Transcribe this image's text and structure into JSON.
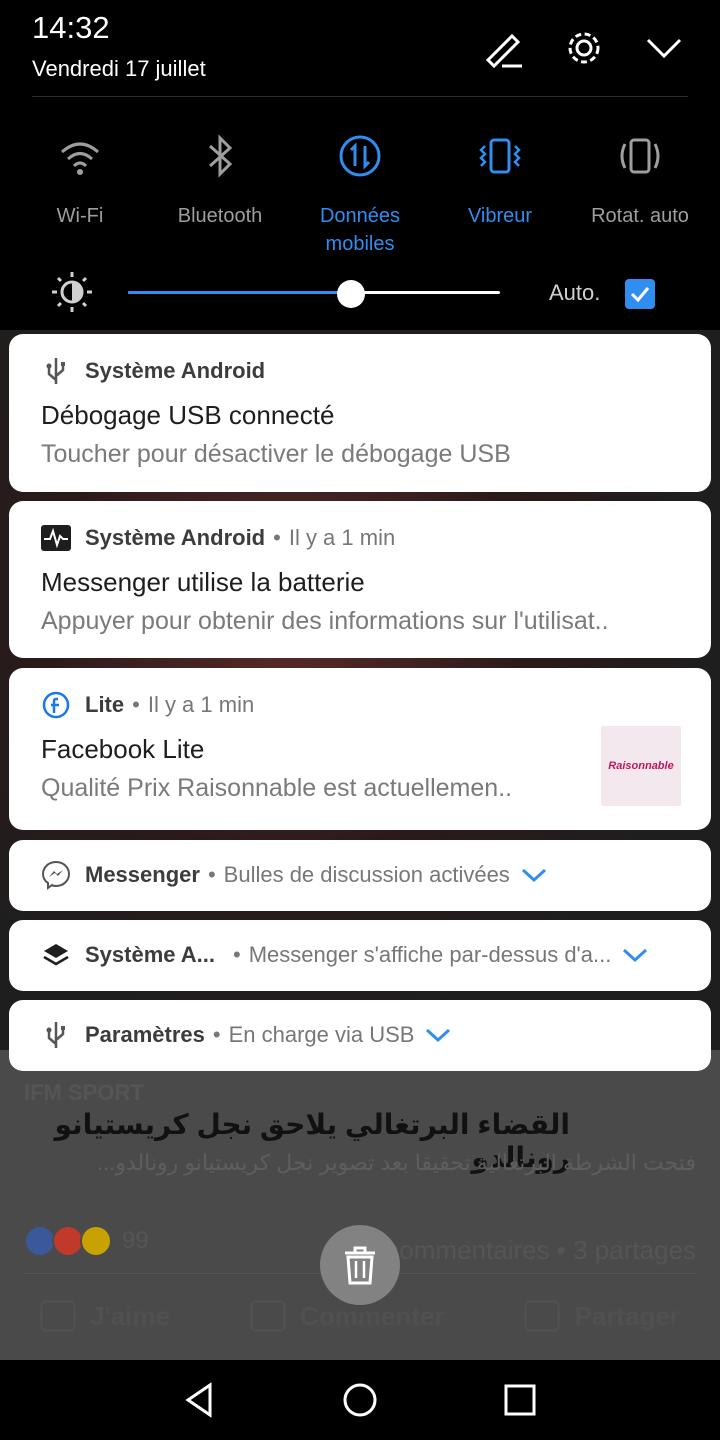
{
  "status": {
    "time": "14:32",
    "date": "Vendredi 17 juillet",
    "icons": [
      "edit-icon",
      "settings-gear-icon",
      "collapse-chevron-icon"
    ]
  },
  "toggles": [
    {
      "label": "Wi-Fi",
      "icon": "wifi-icon",
      "active": false
    },
    {
      "label": "Bluetooth",
      "icon": "bluetooth-icon",
      "active": false
    },
    {
      "label": "Données\nmobiles",
      "icon": "mobile-data-icon",
      "active": true
    },
    {
      "label": "Vibreur",
      "icon": "vibrate-icon",
      "active": true
    },
    {
      "label": "Rotat. auto",
      "icon": "auto-rotate-icon",
      "active": false
    }
  ],
  "brightness": {
    "level": 0.6,
    "auto_label": "Auto.",
    "auto_checked": true
  },
  "notifications": [
    {
      "app": "Système Android",
      "icon": "usb-icon",
      "title": "Débogage USB connecté",
      "text": "Toucher pour désactiver le débogage USB"
    },
    {
      "app": "Système Android",
      "time": "Il y a 1 min",
      "icon": "battery-activity-icon",
      "title": "Messenger utilise la batterie",
      "text": "Appuyer pour obtenir des informations sur l'utilisat.."
    },
    {
      "app": "Lite",
      "time": "Il y a 1 min",
      "icon": "facebook-icon",
      "title": "Facebook Lite",
      "text": "Qualité Prix  Raisonnable est actuellemen..",
      "thumbnail_text": "Raisonnable"
    },
    {
      "app": "Messenger",
      "info": "Bulles de discussion activées",
      "icon": "messenger-icon"
    },
    {
      "app": "Système A...",
      "info": "Messenger s'affiche par-dessus d'a...",
      "icon": "layers-icon"
    },
    {
      "app": "Paramètres",
      "info": "En charge via USB",
      "icon": "usb-icon"
    }
  ],
  "background_feed": {
    "source": "IFM SPORT",
    "headline": "القضاء البرتغالي يلاحق نجل كريستيانو رونالدو",
    "subline": "فتحت الشرطة البرتغالية تحقيقا بعد تصوير نجل كريستيانو رونالدو...",
    "reaction_count": "99",
    "comments_shares": "18 commentaires • 3 partages",
    "actions": [
      "J'aime",
      "Commenter",
      "Partager"
    ]
  },
  "colors": {
    "accent": "#2f8ef0",
    "panel": "#000000",
    "card": "#ffffff"
  }
}
